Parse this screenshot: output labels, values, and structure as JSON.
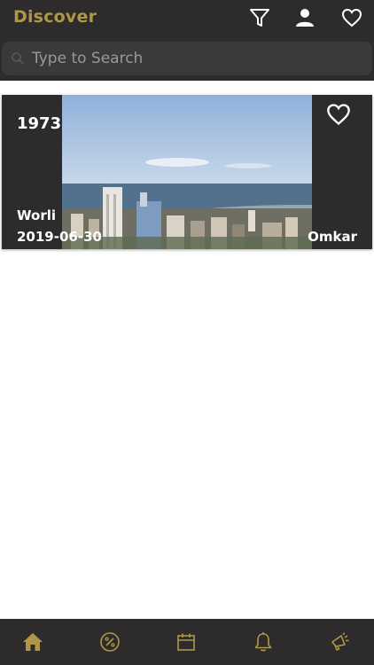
{
  "header": {
    "title": "Discover",
    "icons": [
      "filter-icon",
      "user-icon",
      "heart-icon"
    ]
  },
  "search": {
    "placeholder": "Type to Search"
  },
  "card": {
    "year": "1973",
    "place": "Worli",
    "date": "2019-06-30",
    "author": "Omkar"
  },
  "tabbar": {
    "icons": [
      "home-icon",
      "percent-icon",
      "calendar-icon",
      "bell-icon",
      "megaphone-icon"
    ]
  },
  "colors": {
    "accent": "#b09748",
    "header_bg": "#2d2b2c",
    "search_bg": "#3b393a"
  }
}
